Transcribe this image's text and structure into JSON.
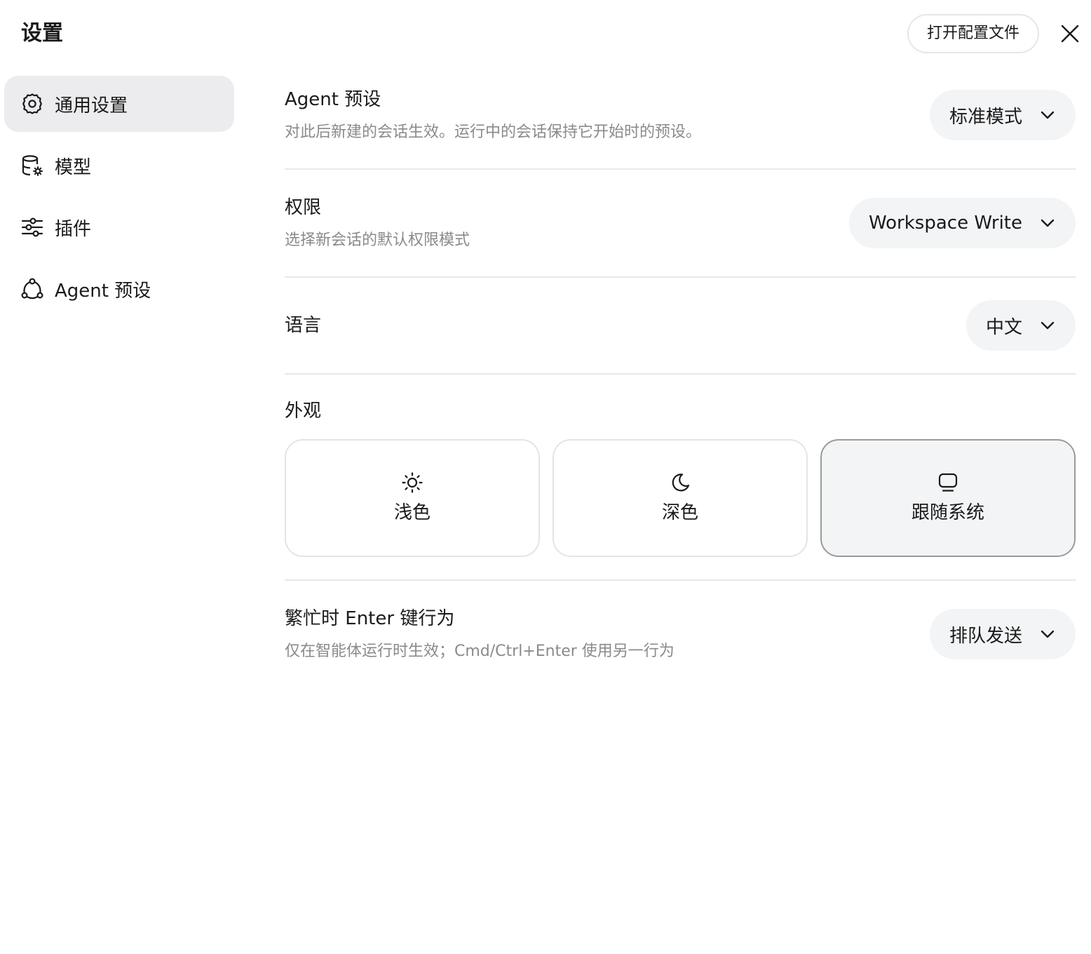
{
  "header": {
    "title": "设置",
    "open_config_label": "打开配置文件",
    "close_icon": "close-icon"
  },
  "sidebar": {
    "items": [
      {
        "label": "通用设置",
        "icon": "gear-icon",
        "active": true
      },
      {
        "label": "模型",
        "icon": "database-gear-icon",
        "active": false
      },
      {
        "label": "插件",
        "icon": "sliders-icon",
        "active": false
      },
      {
        "label": "Agent 预设",
        "icon": "agent-network-icon",
        "active": false
      }
    ]
  },
  "settings": {
    "agent_preset": {
      "title": "Agent 预设",
      "description": "对此后新建的会话生效。运行中的会话保持它开始时的预设。",
      "value": "标准模式"
    },
    "permission": {
      "title": "权限",
      "description": "选择新会话的默认权限模式",
      "value": "Workspace Write"
    },
    "language": {
      "title": "语言",
      "value": "中文"
    },
    "appearance": {
      "title": "外观",
      "options": [
        {
          "label": "浅色",
          "icon": "sun-icon",
          "selected": false
        },
        {
          "label": "深色",
          "icon": "moon-icon",
          "selected": false
        },
        {
          "label": "跟随系统",
          "icon": "monitor-icon",
          "selected": true
        }
      ]
    },
    "busy_enter": {
      "title": "繁忙时 Enter 键行为",
      "description": "仅在智能体运行时生效；Cmd/Ctrl+Enter 使用另一行为",
      "value": "排队发送"
    }
  },
  "colors": {
    "active_nav_bg": "#ececee",
    "dropdown_bg": "#f3f4f5",
    "selected_card_border": "#9a9a9a",
    "muted_text": "#8a8a8a"
  }
}
